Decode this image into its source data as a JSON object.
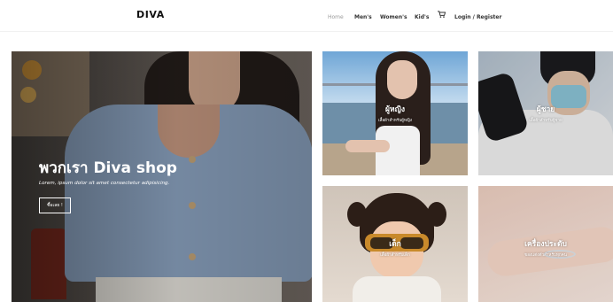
{
  "header": {
    "brand": "DIVA",
    "nav": [
      {
        "label": "Home",
        "active": true
      },
      {
        "label": "Men's",
        "active": false
      },
      {
        "label": "Women's",
        "active": false
      },
      {
        "label": "Kid's",
        "active": false
      }
    ],
    "cart_icon": "cart-icon",
    "login_register": "Login / Register"
  },
  "hero": {
    "title": "พวกเรา Diva shop",
    "subtitle": "Lorem, ipsum dolor sit amet consectetur adipisicing.",
    "button": "ซื้อเลย !"
  },
  "categories": [
    {
      "title": "ผู้หญิง",
      "subtitle": "เสื้อผ้าสำหรับผู้หญิง"
    },
    {
      "title": "ผู้ชาย",
      "subtitle": "เสื้อผ้าสำหรับผู้ชาย"
    },
    {
      "title": "เด็ก",
      "subtitle": "เสื้อผ้าสำหรับเด็ก"
    },
    {
      "title": "เครื่องประดับ",
      "subtitle": "ของแต่งตัวสำหรับทุกคน"
    }
  ],
  "colors": {
    "brand_text": "#111111",
    "nav_active": "#9a9a9a",
    "overlay_text": "#ffffff"
  }
}
